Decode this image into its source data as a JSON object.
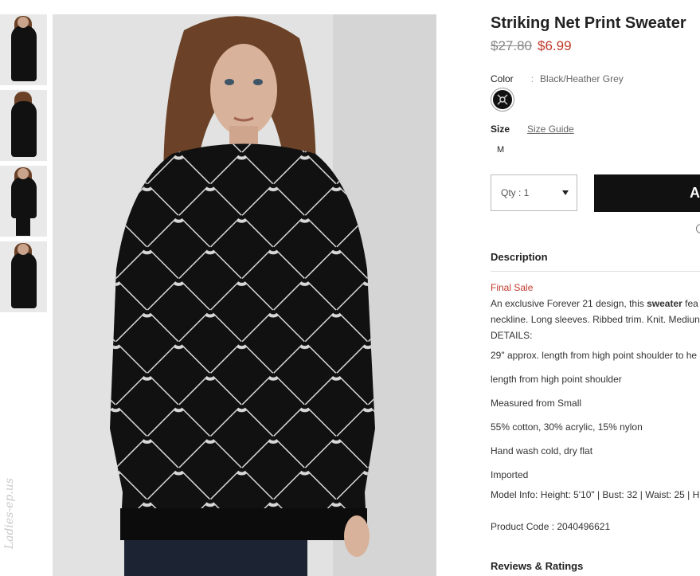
{
  "product": {
    "title": "Striking Net Print Sweater",
    "price_original": "$27.80",
    "price_sale": "$6.99",
    "color_label": "Color",
    "color_separator": ":",
    "color_value": "Black/Heather Grey",
    "size_label": "Size",
    "size_guide": "Size Guide",
    "sizes": [
      "M"
    ],
    "qty_label": "Qty : 1",
    "add_to_bag_label": "A"
  },
  "description": {
    "heading": "Description",
    "final_sale": "Final Sale",
    "intro_before": "An exclusive Forever 21 design, this ",
    "intro_bold": "sweater",
    "intro_after": " fea",
    "line2": "neckline. Long sleeves. Ribbed trim. Knit. Mediun",
    "details_label": "DETAILS:",
    "bullets": [
      "29\" approx. length from high point shoulder to he",
      "length from high point shoulder",
      "Measured from Small",
      "55% cotton, 30% acrylic, 15% nylon",
      "Hand wash cold, dry flat",
      "Imported",
      "Model Info: Height: 5'10\" | Bust: 32 | Waist: 25 | H"
    ],
    "product_code": "Product Code : 2040496621"
  },
  "reviews": {
    "heading": "Reviews & Ratings"
  },
  "watermark": "Ladies-ep.us",
  "colors": {
    "accent_red": "#c0392b",
    "button_black": "#111111",
    "sweater": "#111111",
    "pattern": "#d8d8d8"
  }
}
